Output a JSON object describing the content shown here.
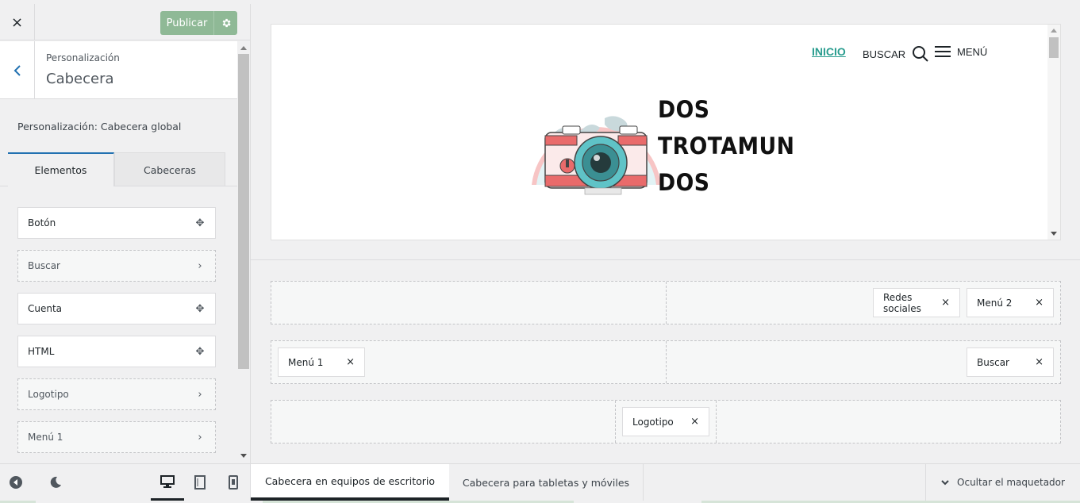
{
  "sidebar": {
    "close_label": "×",
    "publish_label": "Publicar",
    "breadcrumb": "Personalización",
    "panel_title": "Cabecera",
    "section_title": "Personalización: Cabecera global",
    "tabs": [
      {
        "label": "Elementos"
      },
      {
        "label": "Cabeceras"
      }
    ],
    "elements": [
      {
        "label": "Botón",
        "icon": "move-icon"
      },
      {
        "label": "Buscar",
        "icon": "chevron-right-icon"
      },
      {
        "label": "Cuenta",
        "icon": "move-icon"
      },
      {
        "label": "HTML",
        "icon": "move-icon"
      },
      {
        "label": "Logotipo",
        "icon": "chevron-right-icon"
      },
      {
        "label": "Menú 1",
        "icon": "chevron-right-icon"
      }
    ]
  },
  "preview": {
    "nav": {
      "inicio": "INICIO",
      "buscar": "BUSCAR",
      "menu": "MENÚ"
    },
    "logo_lines": [
      "DOS",
      "TROTAMUN",
      "DOS"
    ],
    "accent_color": "#2a9d8f"
  },
  "builder": {
    "top_row": {
      "right_items": [
        {
          "label": "Redes sociales"
        },
        {
          "label": "Menú 2"
        }
      ]
    },
    "main_row": {
      "left_items": [
        {
          "label": "Menú 1"
        }
      ],
      "right_items": [
        {
          "label": "Buscar"
        }
      ]
    },
    "bottom_row": {
      "center_items": [
        {
          "label": "Logotipo"
        }
      ]
    },
    "remove_symbol": "×"
  },
  "bottombar": {
    "tabs": [
      {
        "label": "Cabecera en equipos de escritorio"
      },
      {
        "label": "Cabecera para tabletas y móviles"
      }
    ],
    "hide_label": "Ocultar el maquetador"
  }
}
